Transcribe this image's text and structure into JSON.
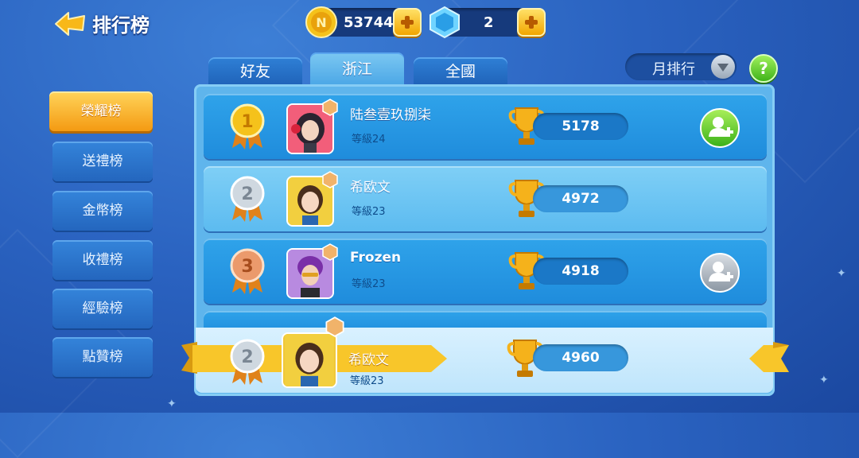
{
  "header": {
    "title": "排行榜",
    "coins": "53744",
    "gems": "2"
  },
  "tabs": [
    {
      "label": "好友"
    },
    {
      "label": "浙江",
      "active": true
    },
    {
      "label": "全國"
    }
  ],
  "period": {
    "label": "月排行"
  },
  "help": {
    "label": "?"
  },
  "sidebar": {
    "items": [
      {
        "label": "榮耀榜",
        "active": true
      },
      {
        "label": "送禮榜"
      },
      {
        "label": "金幣榜"
      },
      {
        "label": "收禮榜"
      },
      {
        "label": "經驗榜"
      },
      {
        "label": "點贊榜"
      }
    ]
  },
  "rows": [
    {
      "rank": "1",
      "name": "陆叁壹玖捌柒",
      "level": "等級24",
      "score": "5178",
      "friend_button": "add-green",
      "avatar": "girl-red-headphones"
    },
    {
      "rank": "2",
      "name": "希欧文",
      "level": "等級23",
      "score": "4972",
      "friend_button": "none",
      "avatar": "girl-brown-hair"
    },
    {
      "rank": "3",
      "name": "Frozen",
      "level": "等級23",
      "score": "4918",
      "friend_button": "add-grey",
      "avatar": "boy-purple-hair"
    }
  ],
  "self_row": {
    "rank": "2",
    "name": "希欧文",
    "level": "等級23",
    "score": "4960"
  },
  "colors": {
    "medal_gold": "#f5c21b",
    "medal_silver": "#c9d2db",
    "medal_bronze": "#e08a5a",
    "accent_orange": "#f49a12",
    "friend_green": "#3cb21a"
  }
}
